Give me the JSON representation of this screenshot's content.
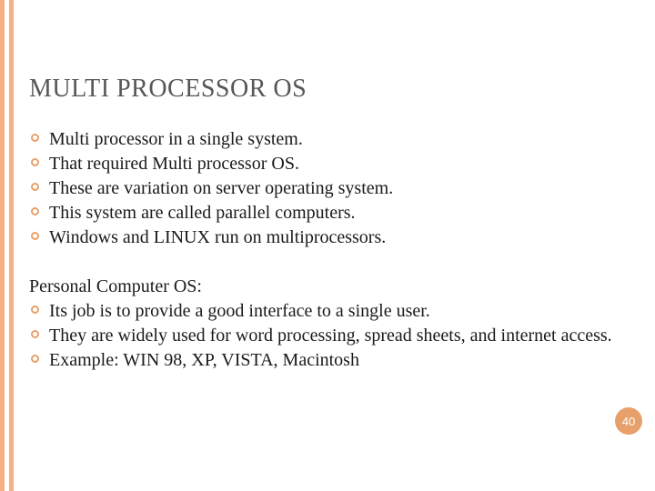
{
  "title": "MULTI PROCESSOR OS",
  "bullets1": [
    "Multi processor in a single system.",
    "That required Multi processor OS.",
    "These are variation on server operating system.",
    "This system are called parallel computers.",
    "Windows and LINUX run on multiprocessors."
  ],
  "section2_header": "Personal Computer OS:",
  "bullets2": [
    "Its job is to provide a good interface to a single user.",
    "They are widely used for word processing, spread sheets, and internet access.",
    "Example: WIN 98, XP, VISTA, Macintosh"
  ],
  "page_number": "40",
  "accent_color": "#e8a06a"
}
